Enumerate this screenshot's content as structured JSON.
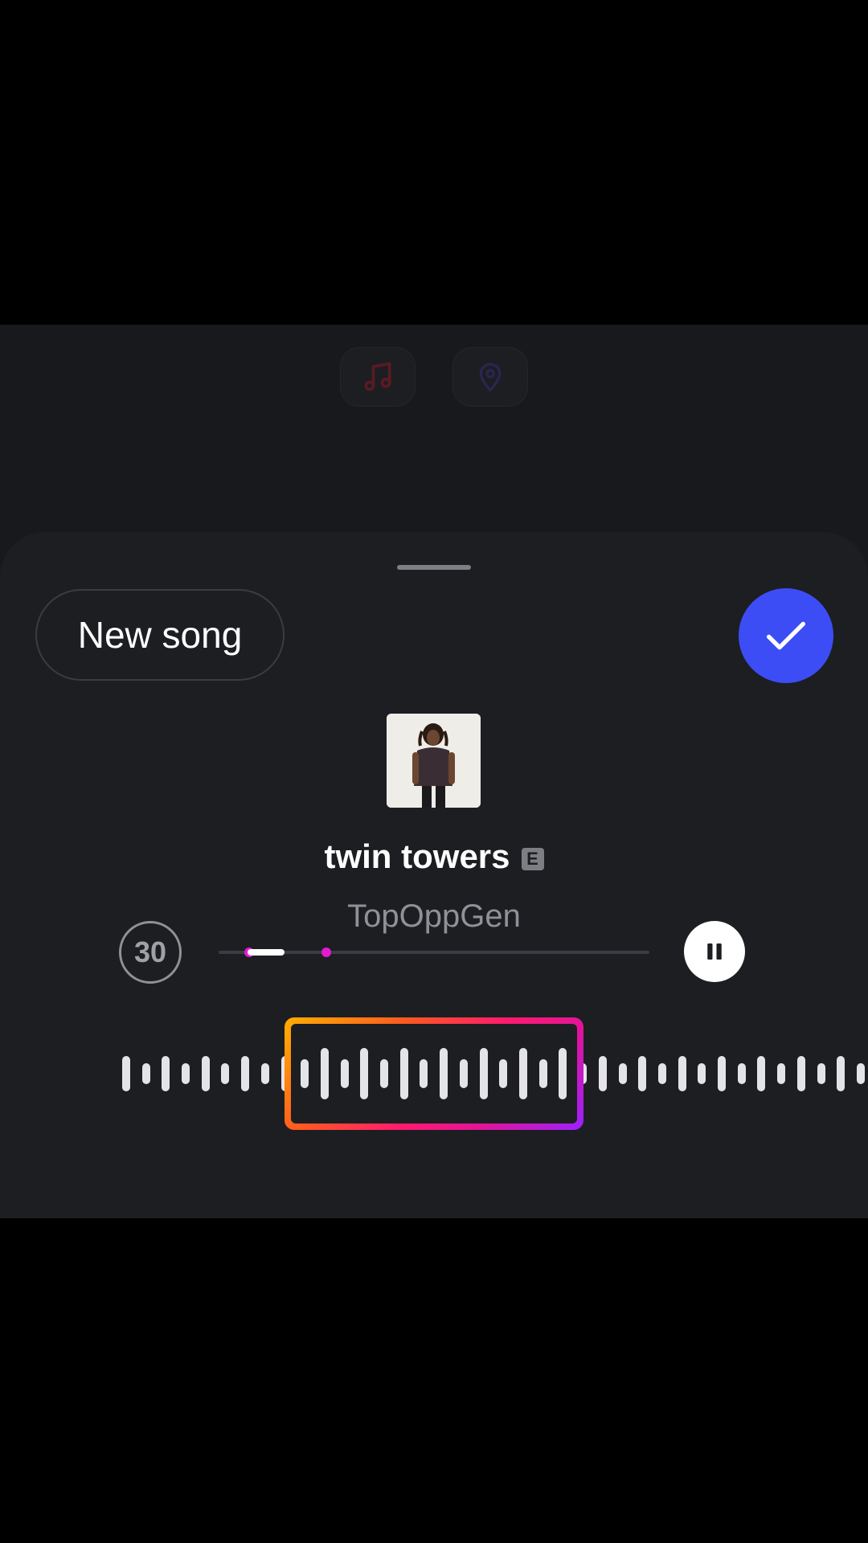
{
  "stickers": [
    {
      "name": "music-icon",
      "color": "#5a1a24"
    },
    {
      "name": "location-pin-icon",
      "color": "#2a2550"
    }
  ],
  "sheet": {
    "new_song_label": "New song",
    "done_icon": "checkmark-icon"
  },
  "track": {
    "title": "twin towers",
    "explicit_badge": "E",
    "artist": "TopOppGen",
    "clip_duration": "30",
    "playback_state": "playing",
    "progress_fraction": 0.14
  },
  "colors": {
    "accent_blue": "#3d4df5",
    "progress_magenta": "#e21bd0",
    "selection_gradient": [
      "#ffb000",
      "#ff1a6e",
      "#9b21ff"
    ]
  }
}
